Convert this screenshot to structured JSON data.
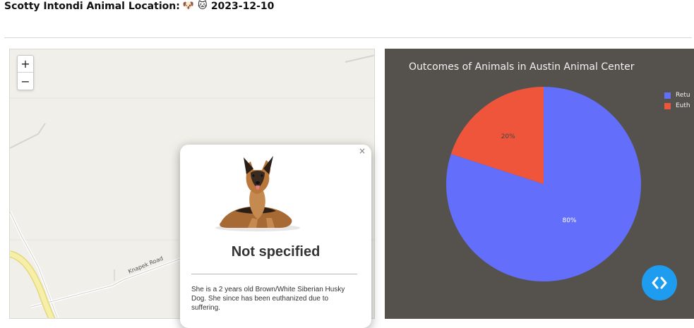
{
  "header": {
    "title": "Scotty Intondi Animal Location:",
    "icons": [
      "dog-face-icon",
      "cat-face-icon"
    ],
    "date": "2023-12-10"
  },
  "map": {
    "zoom_in_label": "+",
    "zoom_out_label": "−",
    "road_label": "Knapek Road"
  },
  "popup": {
    "close_label": "×",
    "image_icon": "german-shepherd-dog-photo",
    "title": "Not specified",
    "description": "She is a 2 years old Brown/White Siberian Husky Dog. She since has been euthanized due to suffering."
  },
  "chart_panel": {
    "background": "#55524e",
    "nav_button_icon": "code-brackets-icon",
    "nav_button_color": "#1e9cf0"
  },
  "chart_data": {
    "type": "pie",
    "title": "Outcomes of Animals in Austin Animal Center",
    "labels": [
      "Retu",
      "Euth"
    ],
    "values": [
      80,
      20
    ],
    "value_labels": [
      "80%",
      "20%"
    ],
    "colors": [
      "#636efa",
      "#ef553b"
    ],
    "legend_placement": "top-right"
  }
}
